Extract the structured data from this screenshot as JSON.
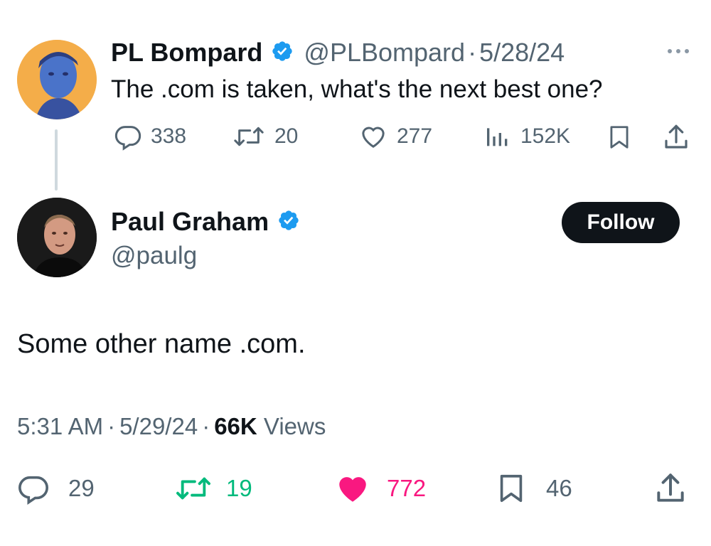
{
  "parent_tweet": {
    "author_name": "PL Bompard",
    "handle": "@PLBompard",
    "separator": "·",
    "date": "5/28/24",
    "text": "The .com is taken, what's the next best one?",
    "replies": "338",
    "retweets": "20",
    "likes": "277",
    "views": "152K"
  },
  "main_tweet": {
    "author_name": "Paul Graham",
    "handle": "@paulg",
    "follow_label": "Follow",
    "text": "Some other name .com.",
    "time": "5:31 AM",
    "sep1": "·",
    "date": "5/29/24",
    "sep2": "·",
    "views_count": "66K",
    "views_label": "Views",
    "replies": "29",
    "retweets": "19",
    "likes": "772",
    "bookmarks": "46"
  },
  "colors": {
    "verified": "#1d9bf0",
    "retweet_active": "#00ba7c",
    "like_active": "#f91880",
    "muted": "#536471",
    "text": "#0f1419"
  },
  "icons": [
    "more-icon",
    "reply-icon",
    "retweet-icon",
    "like-icon",
    "views-icon",
    "bookmark-icon",
    "share-icon",
    "verified-badge-icon"
  ]
}
